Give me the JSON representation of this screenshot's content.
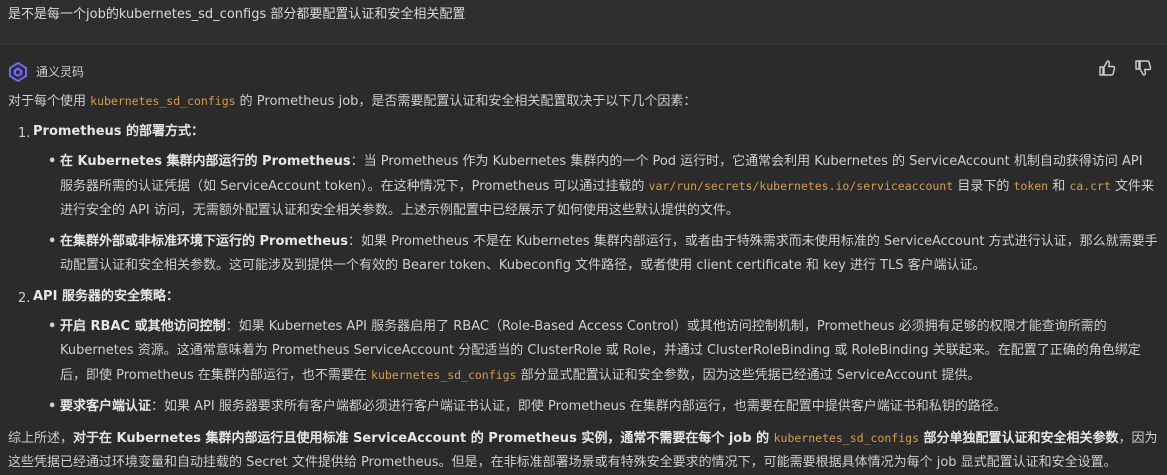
{
  "question": "是不是每一个job的kubernetes_sd_configs 部分都要配置认证和安全相关配置",
  "assistant": {
    "name": "通义灵码",
    "logo_icon": "tongyi-logo-icon"
  },
  "actions": {
    "like_icon": "thumbs-up-icon",
    "dislike_icon": "thumbs-down-icon"
  },
  "intro": {
    "a": "对于每个使用 ",
    "code": "kubernetes_sd_configs",
    "b": " 的 Prometheus job，是否需要配置认证和安全相关配置取决于以下几个因素："
  },
  "item1": {
    "num": "1.",
    "title": "Prometheus 的部署方式：",
    "b1": {
      "bold": "在 Kubernetes 集群内部运行的 Prometheus",
      "t1": "：当 Prometheus 作为 Kubernetes 集群内的一个 Pod 运行时，它通常会利用 Kubernetes 的 ServiceAccount 机制自动获得访问 API 服务器所需的认证凭据（如 ServiceAccount token）。在这种情况下，Prometheus 可以通过挂载的 ",
      "code1": "var/run/secrets/kubernetes.io/serviceaccount",
      "t2": " 目录下的 ",
      "code2": "token",
      "t3": " 和 ",
      "code3": "ca.crt",
      "t4": " 文件来进行安全的 API 访问，无需额外配置认证和安全相关参数。上述示例配置中已经展示了如何使用这些默认提供的文件。"
    },
    "b2": {
      "bold": "在集群外部或非标准环境下运行的 Prometheus",
      "t1": "：如果 Prometheus 不是在 Kubernetes 集群内部运行，或者由于特殊需求而未使用标准的 ServiceAccount 方式进行认证，那么就需要手动配置认证和安全相关参数。这可能涉及到提供一个有效的 Bearer token、Kubeconfig 文件路径，或者使用 client certificate 和 key 进行 TLS 客户端认证。"
    }
  },
  "item2": {
    "num": "2.",
    "title": "API 服务器的安全策略：",
    "b1": {
      "bold": "开启 RBAC 或其他访问控制",
      "t1": "：如果 Kubernetes API 服务器启用了 RBAC（Role-Based Access Control）或其他访问控制机制，Prometheus 必须拥有足够的权限才能查询所需的 Kubernetes 资源。这通常意味着为 Prometheus ServiceAccount 分配适当的 ClusterRole 或 Role，并通过 ClusterRoleBinding 或 RoleBinding 关联起来。在配置了正确的角色绑定后，即使 Prometheus 在集群内部运行，也不需要在 ",
      "code1": "kubernetes_sd_configs",
      "t2": " 部分显式配置认证和安全参数，因为这些凭据已经通过 ServiceAccount 提供。"
    },
    "b2": {
      "bold": "要求客户端认证",
      "t1": "：如果 API 服务器要求所有客户端都必须进行客户端证书认证，即使 Prometheus 在集群内部运行，也需要在配置中提供客户端证书和私钥的路径。"
    }
  },
  "summary": {
    "a": "综上所述，",
    "bold1": "对于在 Kubernetes 集群内部运行且使用标准 ServiceAccount 的 Prometheus 实例，通常不需要在每个 job 的 ",
    "code": "kubernetes_sd_configs",
    "bold2": " 部分单独配置认证和安全相关参数",
    "b": "，因为这些凭据已经通过环境变量和自动挂载的 Secret 文件提供给 Prometheus。但是，在非标准部署场景或有特殊安全要求的情况下，可能需要根据具体情况为每个 job 显式配置认证和安全设置。"
  }
}
